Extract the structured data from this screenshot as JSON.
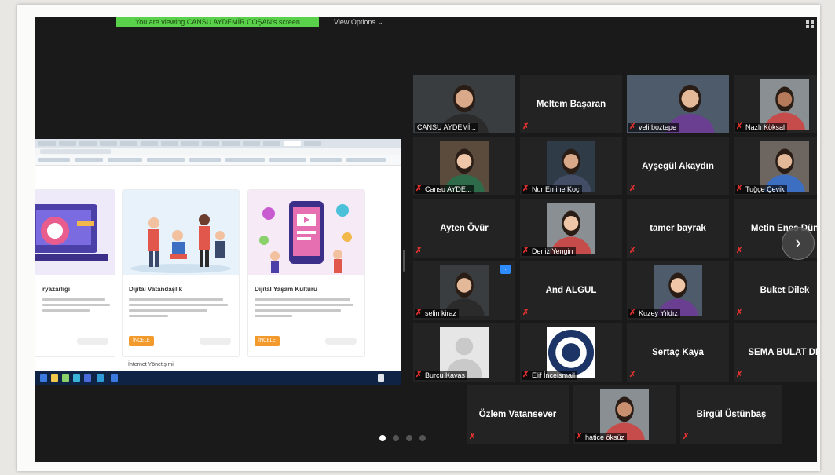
{
  "banner": "You are viewing CANSU AYDEMİR COŞAN's screen",
  "view_options": "View Options ⌄",
  "colors": {
    "active_border": "#b8d86b",
    "mic_muted": "#e0322f",
    "banner_bg": "#5ad14b",
    "accent_blue": "#2d8cff"
  },
  "shared_screen": {
    "cards": [
      {
        "title": "ryazarlığı",
        "button": ""
      },
      {
        "title": "Dijital Vatandaşlık",
        "button": "İNCELE"
      },
      {
        "title": "Dijital Yaşam Kültürü",
        "button": "İNCELE"
      }
    ],
    "extra_text": "İnternet Yönetişimi"
  },
  "participants": [
    {
      "name": "CANSU AYDEMİ...",
      "video": true,
      "active": true,
      "muted": false
    },
    {
      "name": "Meltem Başaran",
      "video": false,
      "muted": true
    },
    {
      "name": "veli boztepe",
      "video": true,
      "muted": true
    },
    {
      "name": "Nazlı Köksal",
      "video": true,
      "muted": true
    },
    {
      "name": "Cansu AYDE...",
      "video": true,
      "muted": true
    },
    {
      "name": "Nur Emine Koç",
      "video": true,
      "muted": true
    },
    {
      "name": "Ayşegül Akaydın",
      "video": false,
      "muted": true
    },
    {
      "name": "Tuğçe Çevik",
      "video": true,
      "muted": true
    },
    {
      "name": "Ayten Övür",
      "video": false,
      "muted": true
    },
    {
      "name": "Deniz Yengin",
      "video": true,
      "muted": true
    },
    {
      "name": "tamer bayrak",
      "video": false,
      "muted": true
    },
    {
      "name": "Metin Enes Dün",
      "video": false,
      "muted": true
    },
    {
      "name": "selin kiraz",
      "video": true,
      "muted": true
    },
    {
      "name": "And ALGUL",
      "video": false,
      "muted": true
    },
    {
      "name": "Kuzey Yıldız",
      "video": true,
      "muted": true
    },
    {
      "name": "Buket Dilek",
      "video": false,
      "muted": true
    },
    {
      "name": "Burcu Kavas",
      "video": true,
      "muted": true
    },
    {
      "name": "Elif İnceismail",
      "video": true,
      "muted": true
    },
    {
      "name": "Sertaç Kaya",
      "video": false,
      "muted": true
    },
    {
      "name": "SEMA BULAT DE",
      "video": false,
      "muted": true
    },
    {
      "name": "Özlem Vatansever",
      "video": false,
      "muted": true
    },
    {
      "name": "hatice öksüz",
      "video": true,
      "muted": true
    },
    {
      "name": "Birgül Üstünbaş",
      "video": false,
      "muted": true
    }
  ],
  "pagination": {
    "pages": 4,
    "current": 1
  },
  "icons": {
    "next": "chevron-right-icon",
    "mic": "mic-muted-icon",
    "layout": "grid-view-icon"
  }
}
